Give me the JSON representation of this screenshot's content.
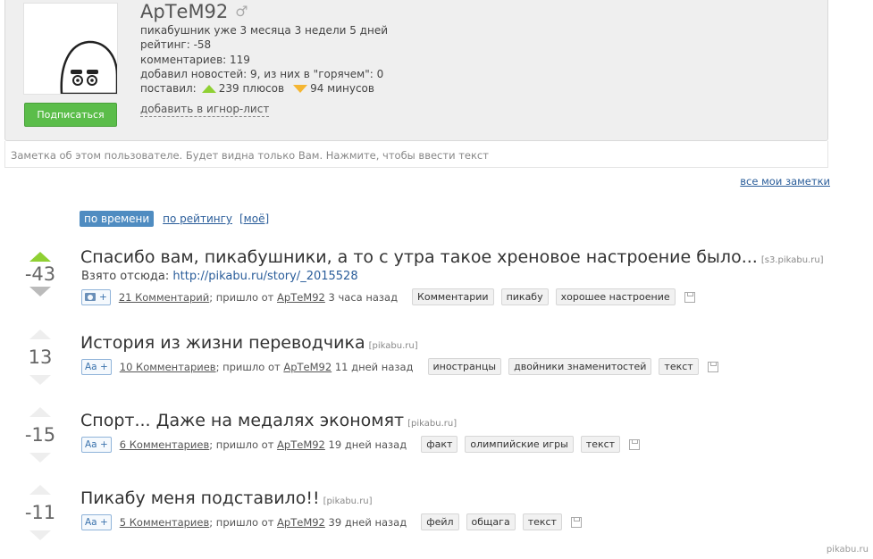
{
  "profile": {
    "username": "АрТеМ92",
    "gender_icon": "male-icon",
    "lines": [
      "пикабушник уже 3 месяца 3 недели 5 дней",
      "рейтинг: -58",
      "комментариев: 119",
      "добавил новостей: 9, из них в \"горячем\": 0"
    ],
    "votes_label": "поставил:",
    "plus_text": "239 плюсов",
    "minus_text": "94 минусов",
    "subscribe_label": "Подписаться",
    "ignore_label": "добавить в игнор-лист"
  },
  "note_placeholder": "Заметка об этом пользователе. Будет видна только Вам. Нажмите, чтобы ввести текст",
  "all_notes_label": "все мои заметки",
  "sort": {
    "active": "по времени",
    "by_rating": "по рейтингу",
    "mine": "[моё]"
  },
  "stories": [
    {
      "rating": "-43",
      "title": "Спасибо вам, пикабушники, а то с утра такое хреновое настроение было...",
      "source": "[s3.pikabu.ru]",
      "subtext_prefix": "Взято отсюда:",
      "subtext_link": "http://pikabu.ru/story/_2015528",
      "badge": "+",
      "comments": "21 Комментарий",
      "from_text": "; пришло от",
      "author": "АрТеМ92",
      "time": "3 часа назад",
      "tags": [
        "Комментарии",
        "пикабу",
        "хорошее настроение"
      ]
    },
    {
      "rating": "13",
      "title": "История из жизни переводчика",
      "source": "[pikabu.ru]",
      "badge": "Aa +",
      "comments": "10 Комментариев",
      "from_text": "; пришло от",
      "author": "АрТеМ92",
      "time": "11 дней назад",
      "tags": [
        "иностранцы",
        "двойники знаменитостей",
        "текст"
      ]
    },
    {
      "rating": "-15",
      "title": "Спорт... Даже на медалях экономят",
      "source": "[pikabu.ru]",
      "badge": "Aa +",
      "comments": "6 Комментариев",
      "from_text": "; пришло от",
      "author": "АрТеМ92",
      "time": "19 дней назад",
      "tags": [
        "факт",
        "олимпийские игры",
        "текст"
      ]
    },
    {
      "rating": "-11",
      "title": "Пикабу меня подставило!!",
      "source": "[pikabu.ru]",
      "badge": "Aa +",
      "comments": "5 Комментариев",
      "from_text": "; пришло от",
      "author": "АрТеМ92",
      "time": "39 дней назад",
      "tags": [
        "фейл",
        "общага",
        "текст"
      ]
    }
  ],
  "watermark": "pikabu.ru",
  "colors": {
    "accent": "#4f8cc1",
    "plus": "#8fd033",
    "minus": "#f5b632",
    "subscribe": "#5bbd4a"
  }
}
